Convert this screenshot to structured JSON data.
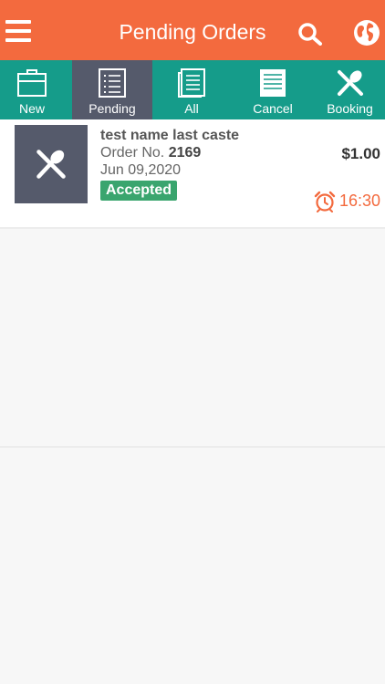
{
  "header": {
    "title": "Pending Orders",
    "menu_icon": "hamburger-menu-icon",
    "search_icon": "search-icon",
    "language_icon": "globe-icon",
    "background": "#f36a3e"
  },
  "tabs": [
    {
      "label": "New",
      "icon": "briefcase-icon",
      "active": false
    },
    {
      "label": "Pending",
      "icon": "list-icon",
      "active": true
    },
    {
      "label": "All",
      "icon": "documents-icon",
      "active": false
    },
    {
      "label": "Cancel",
      "icon": "document-icon",
      "active": false
    },
    {
      "label": "Booking",
      "icon": "fork-spoon-icon",
      "active": false
    }
  ],
  "tab_colors": {
    "bar": "#159c8a",
    "active": "#555a6b"
  },
  "orders": [
    {
      "customer_name": "test name last caste",
      "order_label": "Order No.",
      "order_number": "2169",
      "date": "Jun 09,2020",
      "status": "Accepted",
      "status_color": "#3aa56e",
      "price": "$1.00",
      "time": "16:30",
      "time_color": "#f36a3e",
      "thumb_icon": "fork-spoon-icon"
    }
  ]
}
